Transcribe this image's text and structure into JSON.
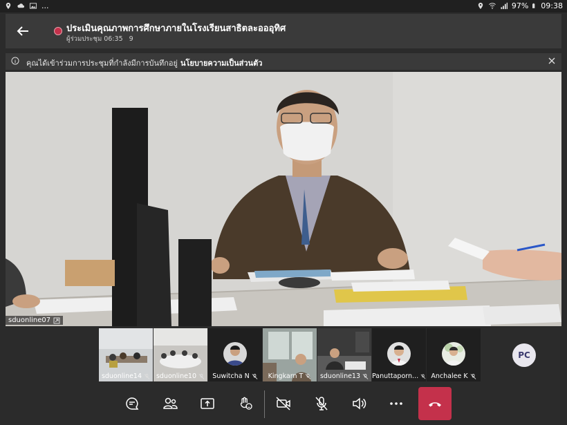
{
  "status_bar": {
    "battery": "97%",
    "time": "09:38",
    "more": "..."
  },
  "header": {
    "title": "ประเมินคุณภาพการศึกษาภายในโรงเรียนสาธิตละอออุทิศ",
    "participants_label": "ผู้ร่วมประชุม",
    "duration": "06:35",
    "participant_count": "9"
  },
  "notice": {
    "text": "คุณได้เข้าร่วมการประชุมที่กำลังมีการบันทึกอยู่",
    "link": "นโยบายความเป็นส่วนตัว"
  },
  "main_video": {
    "name": "sduonline07"
  },
  "gallery": [
    {
      "name": "sduonline14"
    },
    {
      "name": "sduonline10"
    },
    {
      "name": "Suwitcha N"
    },
    {
      "name": "Kingkarn T"
    },
    {
      "name": "sduonline13"
    },
    {
      "name": "Panuttaporn..."
    },
    {
      "name": "Anchalee K"
    }
  ],
  "extra_participant": {
    "initials": "PC"
  },
  "controls": [
    "chat-icon",
    "participants-icon",
    "share-icon",
    "reactions-icon",
    "camera-off-icon",
    "mic-off-icon",
    "speaker-icon",
    "more-icon",
    "hangup-icon"
  ],
  "colors": {
    "record": "#c4314b",
    "hangup": "#c4314b",
    "background": "#2b2b2b"
  }
}
